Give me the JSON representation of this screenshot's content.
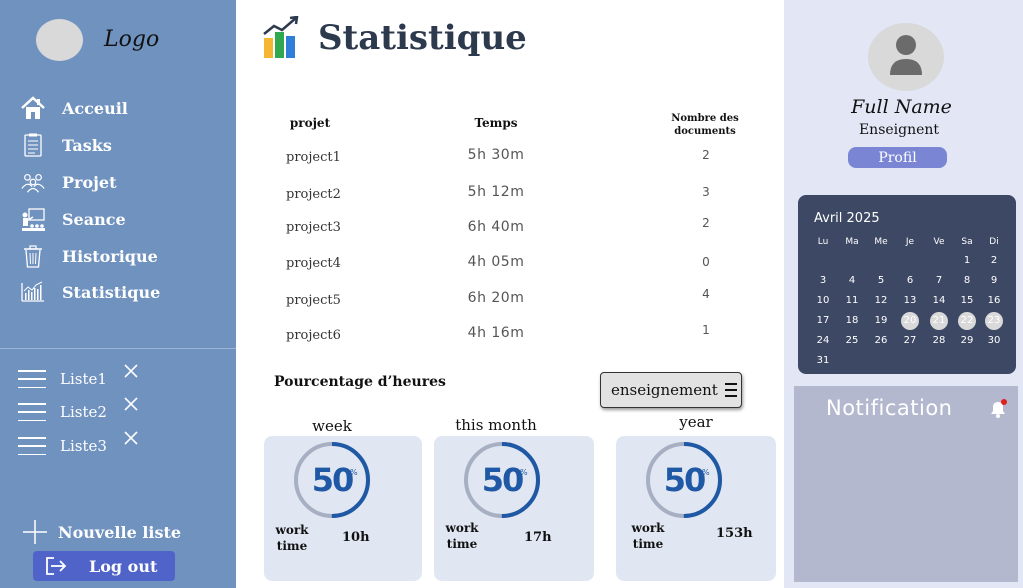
{
  "sidebar": {
    "logo": "Logo",
    "nav": [
      {
        "label": "Acceuil",
        "icon": "home-icon"
      },
      {
        "label": "Tasks",
        "icon": "clipboard-icon"
      },
      {
        "label": "Projet",
        "icon": "team-icon"
      },
      {
        "label": "Seance",
        "icon": "presentation-icon"
      },
      {
        "label": "Historique",
        "icon": "trash-icon"
      },
      {
        "label": "Statistique",
        "icon": "bar-chart-icon"
      }
    ],
    "lists": [
      {
        "label": "Liste1"
      },
      {
        "label": "Liste2"
      },
      {
        "label": "Liste3"
      }
    ],
    "new_list": "Nouvelle liste",
    "logout": "Log out"
  },
  "main": {
    "title": "Statistique",
    "table": {
      "headers": {
        "project": "projet",
        "time": "Temps",
        "docs_line1": "Nombre des",
        "docs_line2": "documents"
      },
      "rows": [
        {
          "project": "project1",
          "time": "5h 30m",
          "docs": "2"
        },
        {
          "project": "project2",
          "time": "5h 12m",
          "docs": "3"
        },
        {
          "project": "project3",
          "time": "6h 40m",
          "docs": "2"
        },
        {
          "project": "project4",
          "time": "4h 05m",
          "docs": "0"
        },
        {
          "project": "project5",
          "time": "6h 20m",
          "docs": "4"
        },
        {
          "project": "project6",
          "time": "4h 16m",
          "docs": "1"
        }
      ]
    },
    "percentage_title": "Pourcentage d’heures",
    "select_value": "enseignement",
    "cards": [
      {
        "period": "week",
        "value": "50",
        "pct_sign": "%",
        "percent": 50,
        "label_line1": "work",
        "label_line2": "time",
        "hours": "10h"
      },
      {
        "period": "this month",
        "value": "50",
        "pct_sign": "%",
        "percent": 50,
        "label_line1": "work",
        "label_line2": "time",
        "hours": "17h"
      },
      {
        "period": "year",
        "value": "50",
        "pct_sign": "%",
        "percent": 50,
        "label_line1": "work",
        "label_line2": "time",
        "hours": "153h"
      }
    ]
  },
  "profile": {
    "full_name": "Full Name",
    "role": "Enseignent",
    "button": "Profil"
  },
  "calendar": {
    "month": "Avril 2025",
    "weekdays": [
      "Lu",
      "Ma",
      "Me",
      "Je",
      "Ve",
      "Sa",
      "Di"
    ],
    "weeks": [
      [
        "",
        "",
        "",
        "",
        "",
        "1",
        "2"
      ],
      [
        "3",
        "4",
        "5",
        "6",
        "7",
        "8",
        "9"
      ],
      [
        "10",
        "11",
        "12",
        "13",
        "14",
        "15",
        "16"
      ],
      [
        "17",
        "18",
        "19",
        "20",
        "21",
        "22",
        "23"
      ],
      [
        "24",
        "25",
        "26",
        "27",
        "28",
        "29",
        "30"
      ],
      [
        "31",
        "",
        "",
        "",
        "",
        "",
        ""
      ]
    ],
    "highlighted": [
      "20",
      "21",
      "22",
      "23"
    ]
  },
  "notification": {
    "title": "Notification"
  },
  "colors": {
    "sidebar": "#7092bf",
    "accent_blue": "#1f58a4",
    "ring_track": "#a7b0c2",
    "calendar_bg": "#3d4864",
    "logout_bg": "#4f63c9",
    "notification_dot": "#e0201b"
  }
}
